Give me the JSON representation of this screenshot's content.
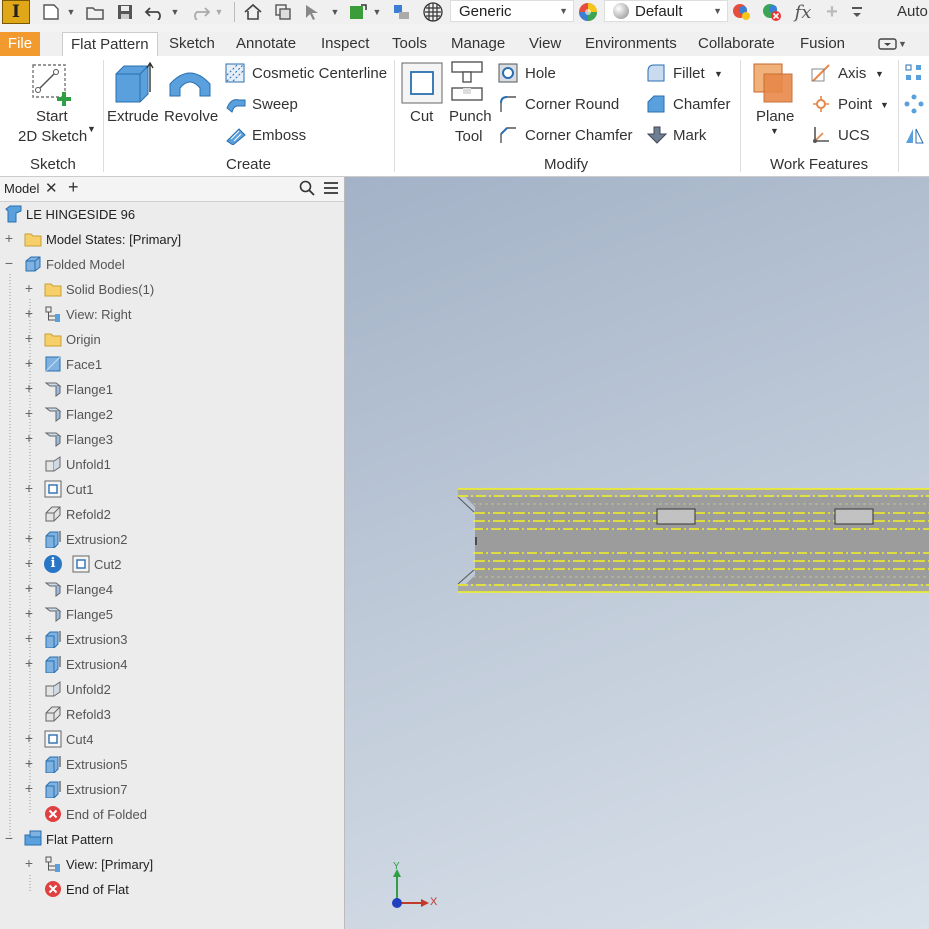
{
  "qat": {
    "material": "Generic",
    "appearance": "Default",
    "overflow_label": "Auto"
  },
  "tabs": [
    "File",
    "Flat Pattern",
    "Sketch",
    "Annotate",
    "Inspect",
    "Tools",
    "Manage",
    "View",
    "Environments",
    "Collaborate",
    "Fusion"
  ],
  "active_tab": "Flat Pattern",
  "ribbon": {
    "sketch": {
      "start_line1": "Start",
      "start_line2": "2D Sketch",
      "title": "Sketch"
    },
    "create": {
      "extrude": "Extrude",
      "revolve": "Revolve",
      "cosmetic_centerline": "Cosmetic Centerline",
      "sweep": "Sweep",
      "emboss": "Emboss",
      "title": "Create"
    },
    "modify": {
      "cut": "Cut",
      "punch_line1": "Punch",
      "punch_line2": "Tool",
      "hole": "Hole",
      "corner_round": "Corner Round",
      "corner_chamfer": "Corner Chamfer",
      "fillet": "Fillet",
      "chamfer": "Chamfer",
      "mark": "Mark",
      "title": "Modify"
    },
    "work": {
      "plane": "Plane",
      "axis": "Axis",
      "point": "Point",
      "ucs": "UCS",
      "title": "Work Features"
    }
  },
  "browser": {
    "tab_label": "Model",
    "root": "LE HINGESIDE 96",
    "nodes": [
      {
        "label": "Model States: [Primary]",
        "icon": "folder-icon"
      },
      {
        "label": "Folded Model",
        "icon": "folded-model-icon"
      },
      {
        "label": "Solid Bodies(1)",
        "icon": "folder-icon"
      },
      {
        "label": "View: Right",
        "icon": "view-icon"
      },
      {
        "label": "Origin",
        "icon": "folder-icon"
      },
      {
        "label": "Face1",
        "icon": "face-icon"
      },
      {
        "label": "Flange1",
        "icon": "flange-icon"
      },
      {
        "label": "Flange2",
        "icon": "flange-icon"
      },
      {
        "label": "Flange3",
        "icon": "flange-icon"
      },
      {
        "label": "Unfold1",
        "icon": "unfold-icon"
      },
      {
        "label": "Cut1",
        "icon": "cut-icon"
      },
      {
        "label": "Refold2",
        "icon": "refold-icon"
      },
      {
        "label": "Extrusion2",
        "icon": "extrusion-icon"
      },
      {
        "label": "Cut2",
        "icon": "cut-icon"
      },
      {
        "label": "Flange4",
        "icon": "flange-icon"
      },
      {
        "label": "Flange5",
        "icon": "flange-icon"
      },
      {
        "label": "Extrusion3",
        "icon": "extrusion-icon"
      },
      {
        "label": "Extrusion4",
        "icon": "extrusion-icon"
      },
      {
        "label": "Unfold2",
        "icon": "unfold-icon"
      },
      {
        "label": "Refold3",
        "icon": "refold-icon"
      },
      {
        "label": "Cut4",
        "icon": "cut-icon"
      },
      {
        "label": "Extrusion5",
        "icon": "extrusion-icon"
      },
      {
        "label": "Extrusion7",
        "icon": "extrusion-icon"
      },
      {
        "label": "End of Folded",
        "icon": "end-of-part-icon"
      },
      {
        "label": "Flat Pattern",
        "icon": "flat-pattern-icon"
      },
      {
        "label": "View: [Primary]",
        "icon": "view-icon"
      },
      {
        "label": "End of Flat",
        "icon": "end-of-part-icon"
      }
    ]
  },
  "triad": {
    "x_label": "X",
    "y_label": "Y"
  },
  "colors": {
    "file_tab": "#f29a2e",
    "edge_highlight": "#f2f21c",
    "viewport_top": "#a3b2c7",
    "viewport_bottom": "#d9e1ea"
  }
}
